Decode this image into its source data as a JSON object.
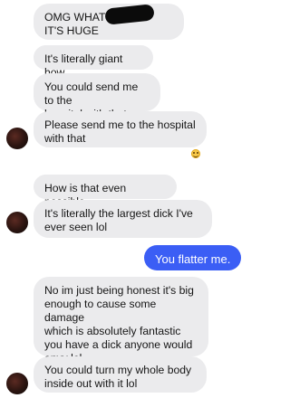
{
  "chat": {
    "messages": [
      {
        "id": "m1",
        "direction": "incoming",
        "text": "OMG WHAT          WHAT\nIT'S HUGE"
      },
      {
        "id": "m2",
        "direction": "incoming",
        "text": "It's literally giant how"
      },
      {
        "id": "m3",
        "direction": "incoming",
        "text": "You could send me to the\nhospital with that"
      },
      {
        "id": "m4",
        "direction": "incoming",
        "text": "Please send me to the hospital\nwith that"
      },
      {
        "id": "m5",
        "direction": "incoming",
        "text": "How is that even possible"
      },
      {
        "id": "m6",
        "direction": "incoming",
        "text": "It's literally the largest dick I've\never seen lol"
      },
      {
        "id": "m7",
        "direction": "outgoing",
        "text": "You flatter me."
      },
      {
        "id": "m8",
        "direction": "incoming",
        "text": "No im just being honest it's big\nenough to cause some damage\nwhich is absolutely fantastic\nyou have a dick anyone would\nenvy lol"
      },
      {
        "id": "m9",
        "direction": "incoming",
        "text": "You could turn my whole body\ninside out with it lol"
      }
    ],
    "reaction": {
      "icon": "smiling-face-emoji"
    },
    "colors": {
      "incoming_bubble": "#ebebed",
      "outgoing_bubble": "#3b5ef5",
      "incoming_text": "#161616",
      "outgoing_text": "#ffffff"
    }
  }
}
